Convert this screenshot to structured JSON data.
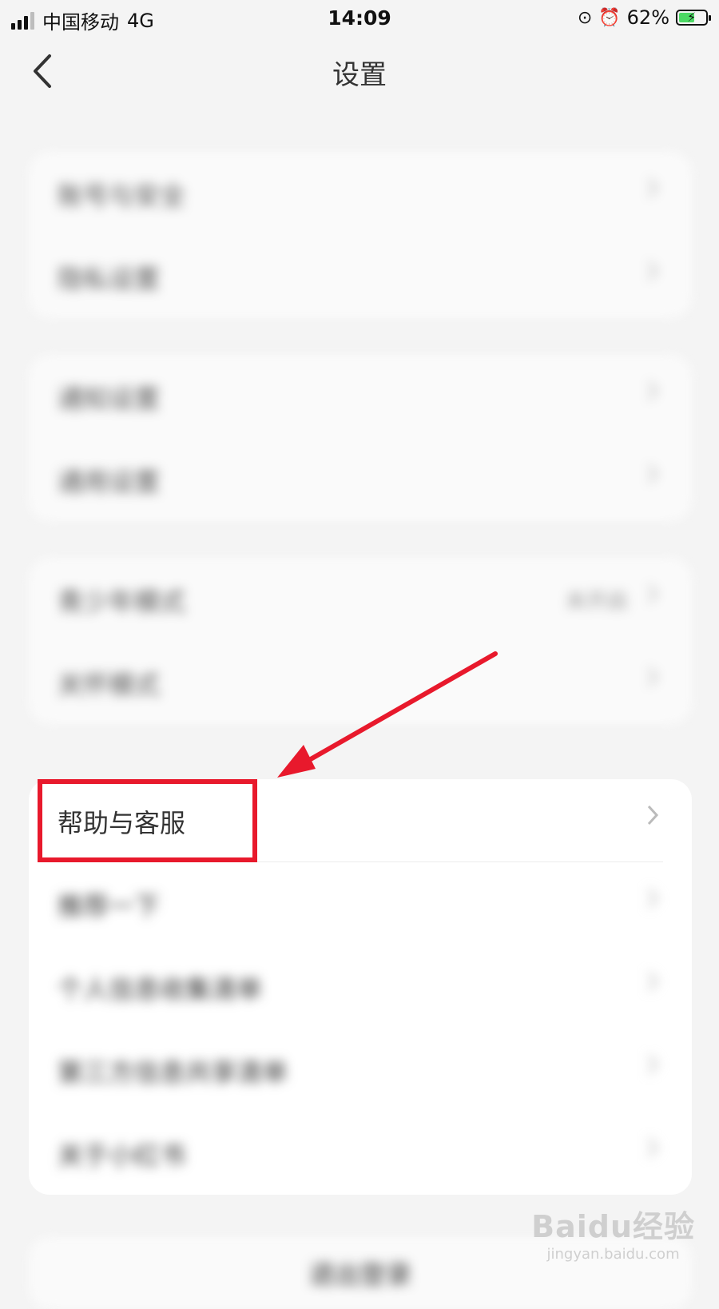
{
  "status_bar": {
    "carrier": "中国移动",
    "network": "4G",
    "time": "14:09",
    "battery_percent": "62%",
    "battery_level": 0.62
  },
  "nav": {
    "title": "设置"
  },
  "groups": [
    {
      "items": [
        {
          "label": "账号与安全"
        },
        {
          "label": "隐私设置"
        }
      ]
    },
    {
      "items": [
        {
          "label": "通知设置"
        },
        {
          "label": "通用设置"
        }
      ]
    },
    {
      "items": [
        {
          "label": "青少年模式",
          "value": "未开启"
        },
        {
          "label": "关怀模式"
        }
      ]
    },
    {
      "items": [
        {
          "label": "帮助与客服"
        },
        {
          "label": "推荐一下"
        },
        {
          "label": "个人信息收集清单"
        },
        {
          "label": "第三方信息共享清单"
        },
        {
          "label": "关于小红书"
        }
      ]
    }
  ],
  "logout": {
    "label": "退出登录"
  },
  "watermark": {
    "main": "Baidu经验",
    "sub": "jingyan.baidu.com"
  },
  "colors": {
    "annotation_red": "#e8192c"
  }
}
